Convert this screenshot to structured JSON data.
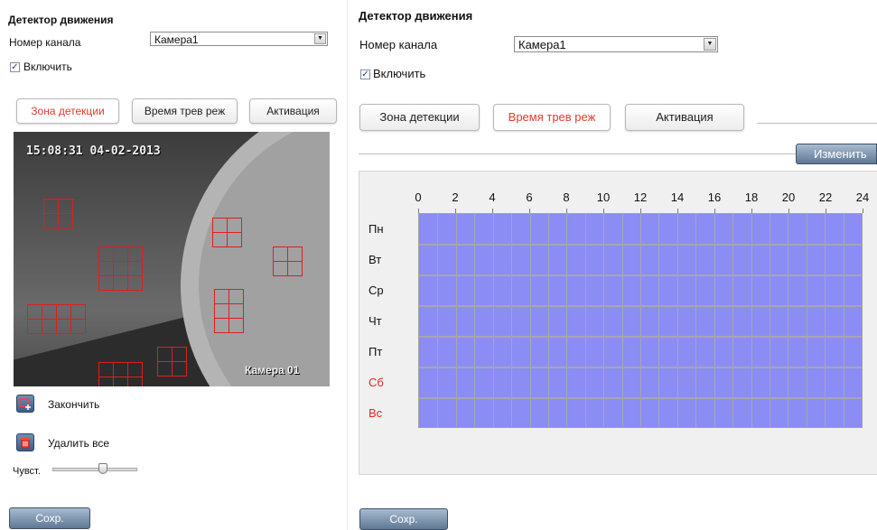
{
  "left_panel": {
    "title": "Детектор движения",
    "channel_label": "Номер канала",
    "channel_value": "Камера1",
    "enable_label": "Включить",
    "enable_checked": true,
    "tabs": [
      {
        "label": "Зона детекции",
        "active": true
      },
      {
        "label": "Время трев реж",
        "active": false
      },
      {
        "label": "Активация",
        "active": false
      }
    ],
    "video": {
      "osd_time": "15:08:31 04-02-2013",
      "osd_camera": "Камера 01"
    },
    "finish_label": "Закончить",
    "delete_all_label": "Удалить все",
    "sensitivity_label": "Чувст.",
    "sensitivity_level": 0.6,
    "save_label": "Сохр."
  },
  "right_panel": {
    "title": "Детектор движения",
    "channel_label": "Номер канала",
    "channel_value": "Камера1",
    "enable_label": "Включить",
    "enable_checked": true,
    "tabs": [
      {
        "label": "Зона детекции",
        "active": false
      },
      {
        "label": "Время трев реж",
        "active": true
      },
      {
        "label": "Активация",
        "active": false
      }
    ],
    "edit_label": "Изменить",
    "schedule": {
      "hour_labels": [
        "0",
        "2",
        "4",
        "6",
        "8",
        "10",
        "12",
        "14",
        "16",
        "18",
        "20",
        "22",
        "24"
      ],
      "days": [
        {
          "label": "Пн",
          "weekend": false
        },
        {
          "label": "Вт",
          "weekend": false
        },
        {
          "label": "Ср",
          "weekend": false
        },
        {
          "label": "Чт",
          "weekend": false
        },
        {
          "label": "Пт",
          "weekend": false
        },
        {
          "label": "Сб",
          "weekend": true
        },
        {
          "label": "Вс",
          "weekend": true
        }
      ],
      "all_armed": true
    },
    "save_label": "Сохр."
  },
  "colors": {
    "active_tab_text": "#e23a2b",
    "weekend_text": "#e0281c",
    "schedule_fill": "#8c8cf5",
    "zone_outline": "#e01e1e",
    "button_blue": "#5f7894"
  },
  "icons": {
    "dropdown": "chevron-down-icon",
    "finish": "draw-area-icon",
    "delete": "trash-icon"
  }
}
